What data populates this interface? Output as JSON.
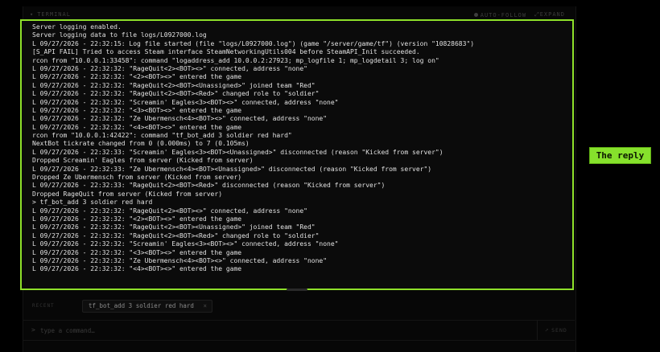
{
  "terminal": {
    "title": "TERMINAL",
    "auto_follow_label": "AUTO-FOLLOW",
    "expand_label": "EXPAND",
    "lines": [
      "Server logging enabled.",
      "Server logging data to file logs/L0927000.log",
      "L 09/27/2026 - 22:32:15: Log file started (file \"logs/L0927000.log\") (game \"/server/game/tf\") (version \"10828683\")",
      "[S_API FAIL] Tried to access Steam interface SteamNetworkingUtils004 before SteamAPI_Init succeeded.",
      "rcon from \"10.0.0.1:33458\": command \"logaddress_add 10.0.0.2:27923; mp_logfile 1; mp_logdetail 3; log on\"",
      "L 09/27/2026 - 22:32:32: \"RageQuit<2><BOT><>\" connected, address \"none\"",
      "L 09/27/2026 - 22:32:32: \"<2><BOT><>\" entered the game",
      "L 09/27/2026 - 22:32:32: \"RageQuit<2><BOT><Unassigned>\" joined team \"Red\"",
      "L 09/27/2026 - 22:32:32: \"RageQuit<2><BOT><Red>\" changed role to \"soldier\"",
      "L 09/27/2026 - 22:32:32: \"Screamin' Eagles<3><BOT><>\" connected, address \"none\"",
      "L 09/27/2026 - 22:32:32: \"<3><BOT><>\" entered the game",
      "L 09/27/2026 - 22:32:32: \"Ze Ubermensch<4><BOT><>\" connected, address \"none\"",
      "L 09/27/2026 - 22:32:32: \"<4><BOT><>\" entered the game",
      "rcon from \"10.0.0.1:42422\": command \"tf_bot_add 3 soldier red hard\"",
      "NextBot tickrate changed from 0 (0.000ms) to 7 (0.105ms)",
      "L 09/27/2026 - 22:32:33: \"Screamin' Eagles<3><BOT><Unassigned>\" disconnected (reason \"Kicked from server\")",
      "Dropped Screamin' Eagles from server (Kicked from server)",
      "L 09/27/2026 - 22:32:33: \"Ze Ubermensch<4><BOT><Unassigned>\" disconnected (reason \"Kicked from server\")",
      "Dropped Ze Ubermensch from server (Kicked from server)",
      "L 09/27/2026 - 22:32:33: \"RageQuit<2><BOT><Red>\" disconnected (reason \"Kicked from server\")",
      "Dropped RageQuit from server (Kicked from server)",
      "> tf_bot_add 3 soldier red hard",
      "L 09/27/2026 - 22:32:32: \"RageQuit<2><BOT><>\" connected, address \"none\"",
      "L 09/27/2026 - 22:32:32: \"<2><BOT><>\" entered the game",
      "L 09/27/2026 - 22:32:32: \"RageQuit<2><BOT><Unassigned>\" joined team \"Red\"",
      "L 09/27/2026 - 22:32:32: \"RageQuit<2><BOT><Red>\" changed role to \"soldier\"",
      "L 09/27/2026 - 22:32:32: \"Screamin' Eagles<3><BOT><>\" connected, address \"none\"",
      "L 09/27/2026 - 22:32:32: \"<3><BOT><>\" entered the game",
      "L 09/27/2026 - 22:32:32: \"Ze Ubermensch<4><BOT><>\" connected, address \"none\"",
      "L 09/27/2026 - 22:32:32: \"<4><BOT><>\" entered the game"
    ]
  },
  "annotation": {
    "label": "The reply",
    "color": "#86e12c"
  },
  "recent": {
    "label": "RECENT",
    "chips": [
      {
        "label": "tf_bot_add 3 soldier red hard"
      }
    ]
  },
  "input": {
    "prompt": ">",
    "placeholder": "type a command…",
    "send_label": "SEND"
  }
}
